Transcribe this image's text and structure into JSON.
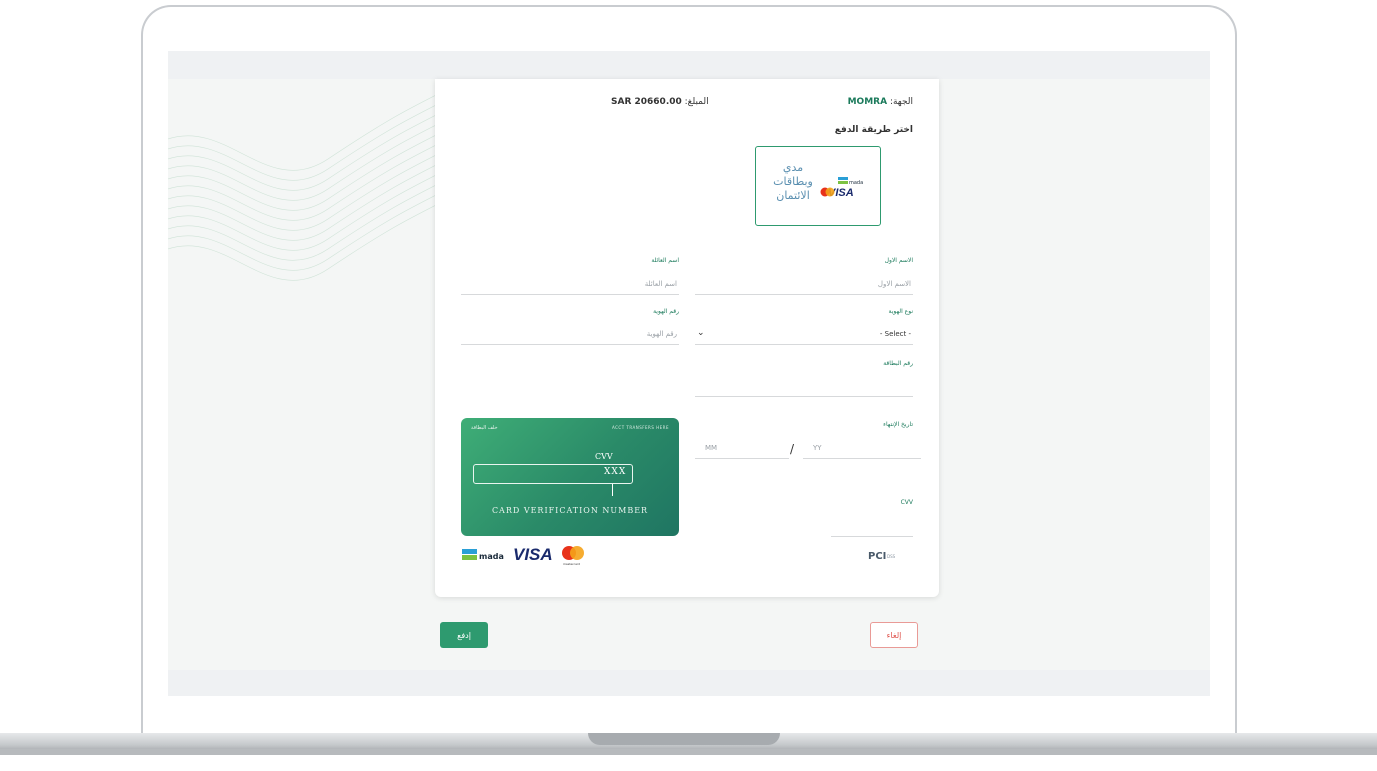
{
  "payment": {
    "entity_label": "الجهة:",
    "entity_value": "MOMRA",
    "amount_label": "المبلغ:",
    "amount_value": "SAR 20660.00",
    "choose_method": "اختر طريقة الدفع",
    "option_label": "مدي وبطاقات الائتمان",
    "mada_word": "mada",
    "visa_word": "VISA"
  },
  "form": {
    "first_name_label": "الاسم الاول",
    "first_name_placeholder": "الاسم الاول",
    "family_name_label": "اسم العائلة",
    "family_name_placeholder": "اسم العائلة",
    "id_type_label": "نوع الهوية",
    "id_type_value": "- Select -",
    "id_number_label": "رقم الهوية",
    "id_number_placeholder": "رقم الهوية",
    "card_number_label": "رقم البطاقة",
    "expiry_label": "تاريخ الإنتهاء",
    "expiry_month_placeholder": "MM",
    "expiry_year_placeholder": "YY",
    "expiry_separator": "/",
    "cvv_label": "CVV"
  },
  "cvv_card": {
    "title": "خلف البطاقة",
    "account_text": "ACCT TRANSFERS HERE",
    "cvv": "CVV",
    "masked": "XXX",
    "caption": "CARD VERIFICATION NUMBER"
  },
  "brands": {
    "mada": "mada",
    "visa": "VISA",
    "mastercard": "mastercard",
    "pci": "PCI",
    "pci_dss": "DSS"
  },
  "buttons": {
    "pay": "إدفع",
    "cancel": "إلغاء"
  },
  "colors": {
    "accent": "#2e9a6f",
    "cancel": "#e0554f",
    "label": "#1b7a5b"
  }
}
